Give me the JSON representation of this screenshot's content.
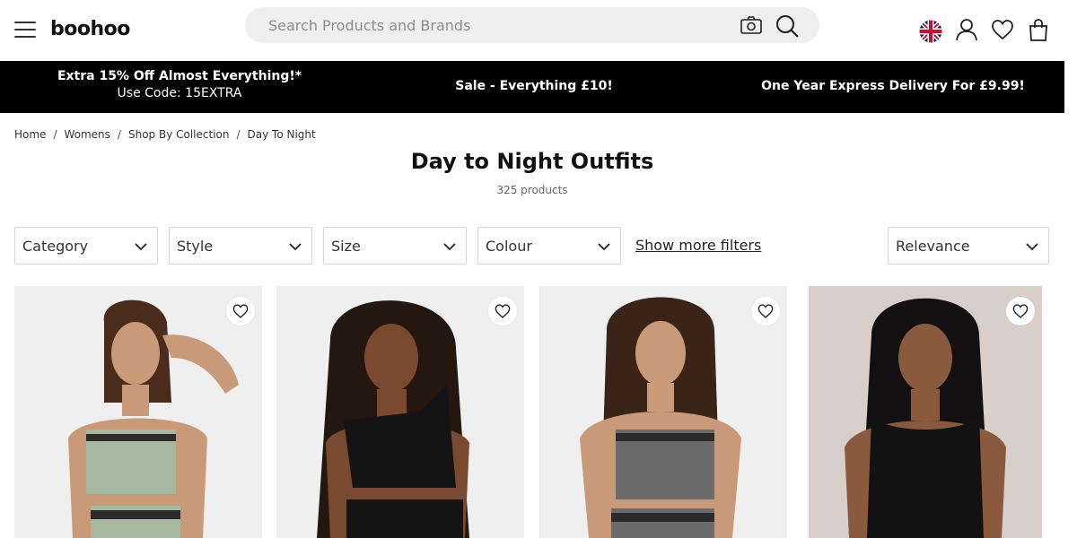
{
  "header": {
    "logo": "boohoo",
    "search_placeholder": "Search Products and Brands",
    "icons": [
      "menu-icon",
      "camera-icon",
      "search-icon",
      "uk-flag-icon",
      "account-icon",
      "heart-icon",
      "bag-icon"
    ]
  },
  "promo": {
    "offer_title": "Extra 15% Off Almost Everything!*",
    "offer_code": "Use Code: 15EXTRA",
    "sale": "Sale - Everything £10!",
    "delivery": "One Year Express Delivery For £9.99!"
  },
  "breadcrumb": [
    "Home",
    "Womens",
    "Shop By Collection",
    "Day To Night"
  ],
  "page": {
    "title": "Day to Night Outfits",
    "count": "325 products"
  },
  "filters": {
    "category": "Category",
    "style": "Style",
    "size": "Size",
    "colour": "Colour",
    "more": "Show more filters",
    "sort": "Relevance"
  },
  "colors": {
    "promo_bg": "#000000",
    "search_bg": "#efefef",
    "card_bg": "#eeeeee"
  }
}
